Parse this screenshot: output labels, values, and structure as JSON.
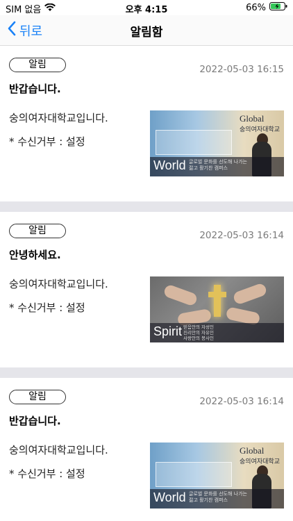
{
  "status_bar": {
    "carrier": "SIM 없음",
    "time": "오후 4:15",
    "battery": "66%"
  },
  "nav": {
    "back_label": "뒤로",
    "title": "알림함"
  },
  "notifications": [
    {
      "badge": "알림",
      "date": "2022-05-03 16:15",
      "title": "반갑습니다.",
      "line1": "숭의여자대학교입니다.",
      "line2": "* 수신거부 : 설정",
      "image": {
        "word": "World",
        "sub1": "글로벌 문화를 선도해 나가는",
        "sub2": "젊고 활기찬 캠퍼스",
        "brand1": "Global",
        "brand2": "숭의여자대학교"
      }
    },
    {
      "badge": "알림",
      "date": "2022-05-03 16:14",
      "title": "안녕하세요.",
      "line1": "숭의여자대학교입니다.",
      "line2": "* 수신거부 : 설정",
      "image": {
        "word": "Spirit",
        "sub1": "믿음안의 자성인",
        "sub2": "진리안의 자유인",
        "sub3": "사랑안의 봉사인"
      }
    },
    {
      "badge": "알림",
      "date": "2022-05-03 16:14",
      "title": "반갑습니다.",
      "line1": "숭의여자대학교입니다.",
      "line2": "* 수신거부 : 설정",
      "image": {
        "word": "World",
        "sub1": "글로벌 문화를 선도해 나가는",
        "sub2": "젊고 활기찬 캠퍼스",
        "brand1": "Global",
        "brand2": "숭의여자대학교"
      }
    }
  ],
  "colors": {
    "accent": "#1a82f7",
    "separator": "#e5e5ea",
    "date_text": "#7a7a7a"
  }
}
